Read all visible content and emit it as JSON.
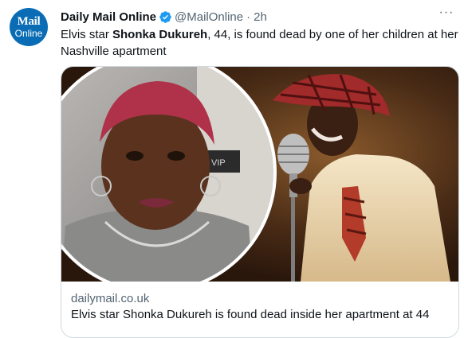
{
  "author": {
    "avatar_line1": "Mail",
    "avatar_line2": "Online",
    "name": "Daily Mail Online",
    "handle": "@MailOnline",
    "separator": "·",
    "time": "2h"
  },
  "tweet": {
    "text_before": "Elvis star ",
    "text_bold": "Shonka Dukureh",
    "text_after": ", 44, is found dead by one of her children at her Nashville apartment"
  },
  "menu": {
    "more_label": "···"
  },
  "card": {
    "image_sign_text": "VIP",
    "domain": "dailymail.co.uk",
    "title": "Elvis star Shonka Dukureh is found dead inside her apartment at 44"
  },
  "colors": {
    "verified": "#1d9bf0",
    "avatar_bg": "#0a6cb4",
    "secondary_text": "#536471",
    "border": "#cfd9de"
  }
}
